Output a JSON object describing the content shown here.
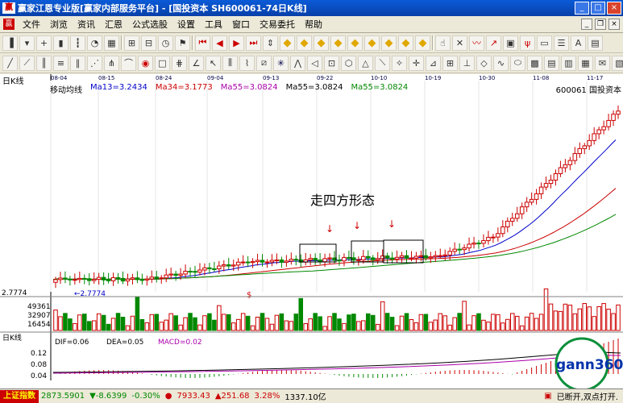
{
  "window": {
    "title": "赢家江恩专业版[赢家内部服务平台] - [国投资本  SH600061-74日K线]",
    "logo": "赢"
  },
  "menu": [
    "文件",
    "浏览",
    "资讯",
    "汇恩",
    "公式选股",
    "设置",
    "工具",
    "窗口",
    "交易委托",
    "帮助"
  ],
  "chart": {
    "panel_label": "日K线",
    "indicator_name": "移动均线",
    "ma_legend": [
      {
        "text": "Ma13=3.2434",
        "color": "#0000cc"
      },
      {
        "text": "Ma34=3.1773",
        "color": "#cc0000"
      },
      {
        "text": "Ma55=3.0824",
        "color": "#aa00aa"
      },
      {
        "text": "Ma55=3.0824",
        "color": "#000000"
      },
      {
        "text": "Ma55=3.0824",
        "color": "#008800"
      }
    ],
    "stock_code": "600061",
    "stock_name": "国投资本",
    "date_ticks": [
      "08-04",
      "08-15",
      "08-24",
      "09-04",
      "09-13",
      "09-22",
      "10-10",
      "10-19",
      "10-30",
      "11-08",
      "11-17"
    ],
    "annotation": "走四方形态",
    "low_label": "2.7774",
    "low_mark": "2.7774",
    "dollar_mark": "$",
    "volume_ticks": [
      "49361",
      "32907",
      "16454"
    ],
    "macd_label": "日K线",
    "macd_legend": [
      {
        "text": "DIF=0.06",
        "color": "#000000"
      },
      {
        "text": "DEA=0.05",
        "color": "#000000"
      },
      {
        "text": "MACD=0.02",
        "color": "#aa00aa"
      }
    ],
    "macd_ticks": [
      "0.12",
      "0.08",
      "0.04"
    ],
    "watermark": "gann360"
  },
  "status": {
    "index_name": "上证指数",
    "sh_value": "2873.5901",
    "sh_change": "▼-8.6399",
    "sh_pct": "-0.30%",
    "sz_value": "7933.43",
    "sz_change": "▲251.68",
    "sz_pct": "3.28%",
    "sz_amount": "1337.10亿",
    "message": "已断开,双点打开."
  }
}
